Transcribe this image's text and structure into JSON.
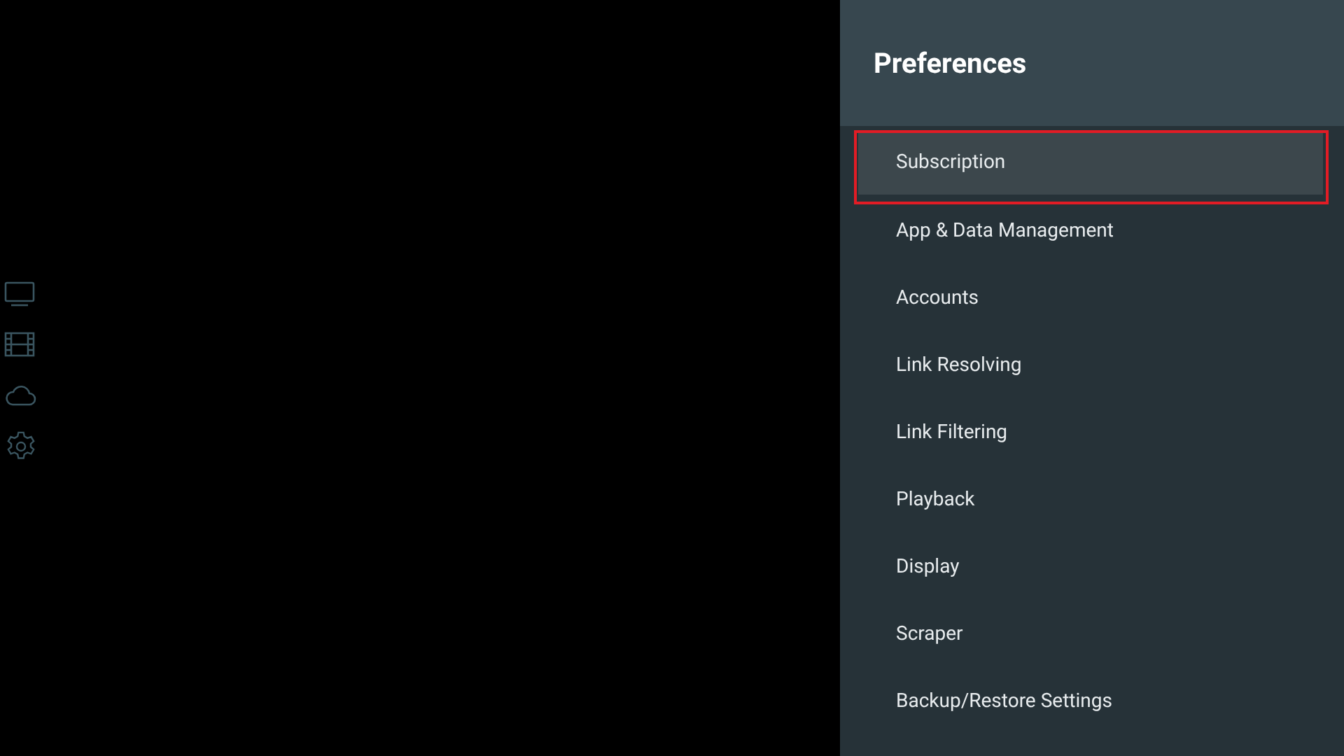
{
  "panel": {
    "title": "Preferences"
  },
  "items": [
    {
      "label": "Subscription",
      "selected": true,
      "highlighted": true
    },
    {
      "label": "App & Data Management",
      "selected": false,
      "highlighted": false
    },
    {
      "label": "Accounts",
      "selected": false,
      "highlighted": false
    },
    {
      "label": "Link Resolving",
      "selected": false,
      "highlighted": false
    },
    {
      "label": "Link Filtering",
      "selected": false,
      "highlighted": false
    },
    {
      "label": "Playback",
      "selected": false,
      "highlighted": false
    },
    {
      "label": "Display",
      "selected": false,
      "highlighted": false
    },
    {
      "label": "Scraper",
      "selected": false,
      "highlighted": false
    },
    {
      "label": "Backup/Restore Settings",
      "selected": false,
      "highlighted": false
    }
  ]
}
